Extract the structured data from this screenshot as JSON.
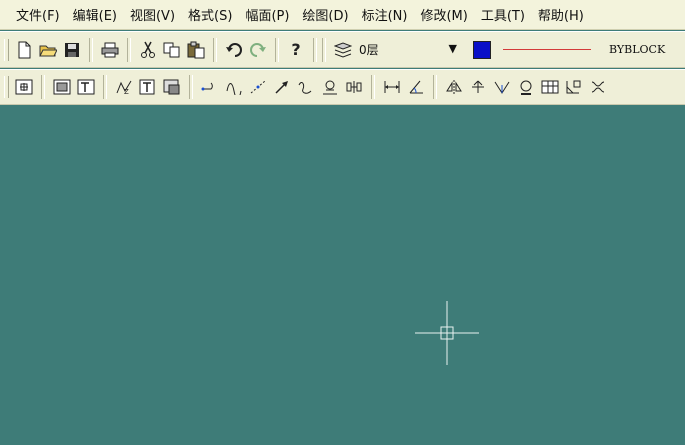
{
  "menubar": {
    "items": [
      {
        "label": "文件(F)"
      },
      {
        "label": "编辑(E)"
      },
      {
        "label": "视图(V)"
      },
      {
        "label": "格式(S)"
      },
      {
        "label": "幅面(P)"
      },
      {
        "label": "绘图(D)"
      },
      {
        "label": "标注(N)"
      },
      {
        "label": "修改(M)"
      },
      {
        "label": "工具(T)"
      },
      {
        "label": "帮助(H)"
      }
    ]
  },
  "toolbar": {
    "layer": {
      "value": "0层"
    },
    "color": {
      "swatch": "#0a10c8"
    },
    "linetype": {
      "label": "BYBLOCK",
      "line_color": "#d33a3a"
    },
    "help_glyph": "?"
  },
  "canvas": {
    "background": "#3e7c78",
    "cursor_color": "#e8f2f0"
  },
  "icons": [
    "new-icon",
    "open-icon",
    "save-icon",
    "print-icon",
    "cut-icon",
    "copy-icon",
    "paste-icon",
    "undo-icon",
    "redo-icon",
    "help-icon",
    "layer-manager-icon",
    "zoom-window-icon",
    "zoom-all-icon",
    "text-icon",
    "polyline-icon",
    "text-insert-icon",
    "block-icon",
    "line-icon",
    "arc-icon",
    "construct-icon",
    "arrow-icon",
    "spline-icon",
    "hatch-icon",
    "symbol-icon",
    "dimension-icon",
    "angle-dimension-icon",
    "mirror-icon",
    "trim-icon",
    "extend-icon",
    "explode-icon",
    "table-icon",
    "chamfer-icon",
    "break-icon"
  ]
}
